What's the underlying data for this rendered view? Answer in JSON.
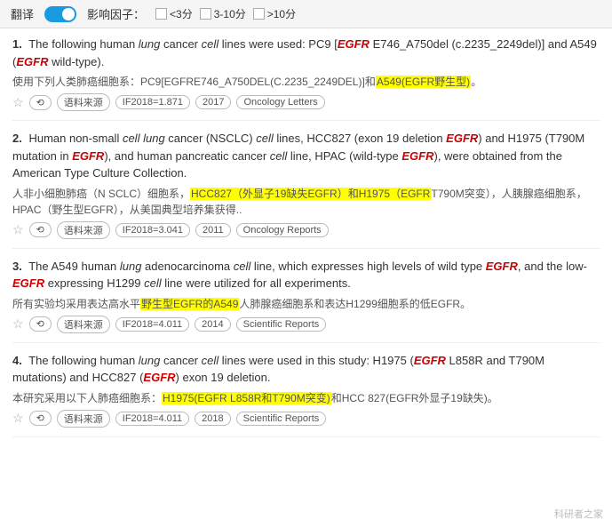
{
  "topbar": {
    "translate_label": "翻译",
    "toggle_state": "on",
    "filter_label": "影响因子：",
    "filter_options": [
      {
        "id": "lt3",
        "label": "<3分"
      },
      {
        "id": "3to10",
        "label": "3-10分"
      },
      {
        "id": "gt10",
        "label": ">10分"
      }
    ]
  },
  "results": [
    {
      "number": "1.",
      "en_text_parts": [
        "The following human ",
        "lung",
        " cancer ",
        "cell",
        " lines were used: PC9 [",
        "EGFR",
        " E746_A750del (c.2235_2249del)] and A549 (",
        "EGFR",
        " wild-type)."
      ],
      "cn_text": "使用下列人类肺癌细胞系：PC9[EGFRE746_A750DEL(C.2235_2249DEL)]和",
      "cn_highlight": "A549(EGFR野生型)。",
      "cn_highlight_style": "yellow",
      "meta": {
        "source": "语料来源",
        "if_value": "IF2018=1.871",
        "year": "2017",
        "journal": "Oncology Letters"
      }
    },
    {
      "number": "2.",
      "en_text_parts": [
        "Human non-small ",
        "cell",
        " ",
        "lung",
        " cancer (NSCLC) ",
        "cell",
        " lines, HCC827 (exon 19 deletion ",
        "EGF",
        "R) and H1975 (T790M mutation in ",
        "EGFR",
        "), and human pancreatic cancer ",
        "cell",
        " line, HPAC (wild-type ",
        "EGFR",
        "), were obtained from the American Type Culture Collection."
      ],
      "cn_text": "人非小细胞肺癌（N SCLC）细胞系，",
      "cn_highlight1": "HCC827（外显子19缺失EGFR）和H1975（EGFR",
      "cn_highlight1_style": "yellow",
      "cn_text2": "T790M突变），人胰腺癌细胞系，HPAC（野生型EGFR），从美国典型培养集获得..",
      "meta": {
        "source": "语料来源",
        "if_value": "IF2018=3.041",
        "year": "2011",
        "journal": "Oncology Reports"
      }
    },
    {
      "number": "3.",
      "en_text_parts": [
        "The A549 human ",
        "lung",
        " adenocarcinoma ",
        "cell",
        " line, which expresses high levels of wild type ",
        "EGFR",
        ", and the low-",
        "EGFR",
        " expressing H1299 ",
        "cell",
        " line were utilized for all experiments."
      ],
      "cn_text": "所有实验均采用表达高水平",
      "cn_highlight": "野生型EGFR的A549",
      "cn_highlight_style": "yellow",
      "cn_text2": "人肺腺癌细胞系和表达H1299细胞系的低EGFR。",
      "meta": {
        "source": "语料来源",
        "if_value": "IF2018=4.011",
        "year": "2014",
        "journal": "Scientific Reports"
      }
    },
    {
      "number": "4.",
      "en_text_parts": [
        "The following human ",
        "lung",
        " cancer ",
        "cell",
        " lines were used in this study: H1975 (",
        "EGFR",
        " L858R and T790M mutations) and HCC827 (",
        "EGFR",
        ") exon 19 deletion."
      ],
      "cn_text": "本研究采用以下人肺癌细胞系：",
      "cn_highlight": "H1975(EGFR L858R和T790M突变)",
      "cn_highlight_style": "yellow",
      "cn_text2": "和HCC 827(EGFR外显子19缺失)。",
      "meta": {
        "source": "语料来源",
        "if_value": "IF2018=4.011",
        "year": "2018",
        "journal": "Scientific Reports"
      }
    }
  ],
  "watermark": "科研者之家"
}
